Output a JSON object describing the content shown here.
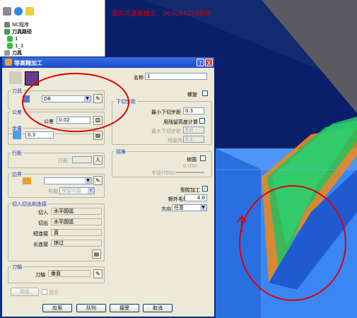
{
  "overlay": {
    "watermark": "我的坦途我做主，064084222制作"
  },
  "explorer": {
    "items": [
      "NC程序",
      "刀具路径",
      "1",
      "1_1",
      "刀具"
    ]
  },
  "dialog": {
    "title": "等高精加工",
    "title_buttons": [
      "?",
      "X"
    ],
    "name_label": "名称",
    "name_value": "1",
    "spiral_label": "螺旋",
    "tool_group": "刀具",
    "tool_value": "D8",
    "tolerance_group": "公差",
    "tolerance_label": "公差",
    "tolerance_value": "0.02",
    "allowance_group": "余量",
    "allowance_value": "0.3",
    "stepdown_group": "下切步距",
    "min_stepdown_label": "最小下切步距",
    "min_stepdown_value": "0.3",
    "residual_label": "用残留高度计算",
    "max_stepdown_label": "最大下切步距",
    "max_stepdown_value": "5.0",
    "residual_height_label": "残留高度",
    "residual_height_value": "0.1",
    "stepover_group": "行距",
    "stepover_label": "行距",
    "corner_group": "拐角",
    "trim_label": "修圆",
    "radius_label": "半径(TDU)",
    "radius_value": "0.050",
    "boundary_group": "边界",
    "trim_boundary_label": "剪裁",
    "trim_boundary_value": "保留内容",
    "climb_label": "型腔加工",
    "extra_height_label": "额外毛坯",
    "extra_height_value": "4.0",
    "direction_label": "方向",
    "direction_value": "任意",
    "leads_group": "切入切出和连接",
    "lead_in_label": "切入",
    "lead_in_value": "水平圆弧",
    "lead_out_label": "切出",
    "lead_out_value": "水平圆弧",
    "short_link_label": "短连接",
    "short_link_value": "直",
    "long_link_label": "长连接",
    "long_link_value": "掠过",
    "axis_group": "刀轴",
    "axis_label": "刀轴",
    "axis_value": "垂直",
    "preview_label": "预览",
    "display_label": "显示",
    "buttons": {
      "apply": "应用",
      "queue": "队列",
      "accept": "接受",
      "cancel": "取消"
    }
  }
}
